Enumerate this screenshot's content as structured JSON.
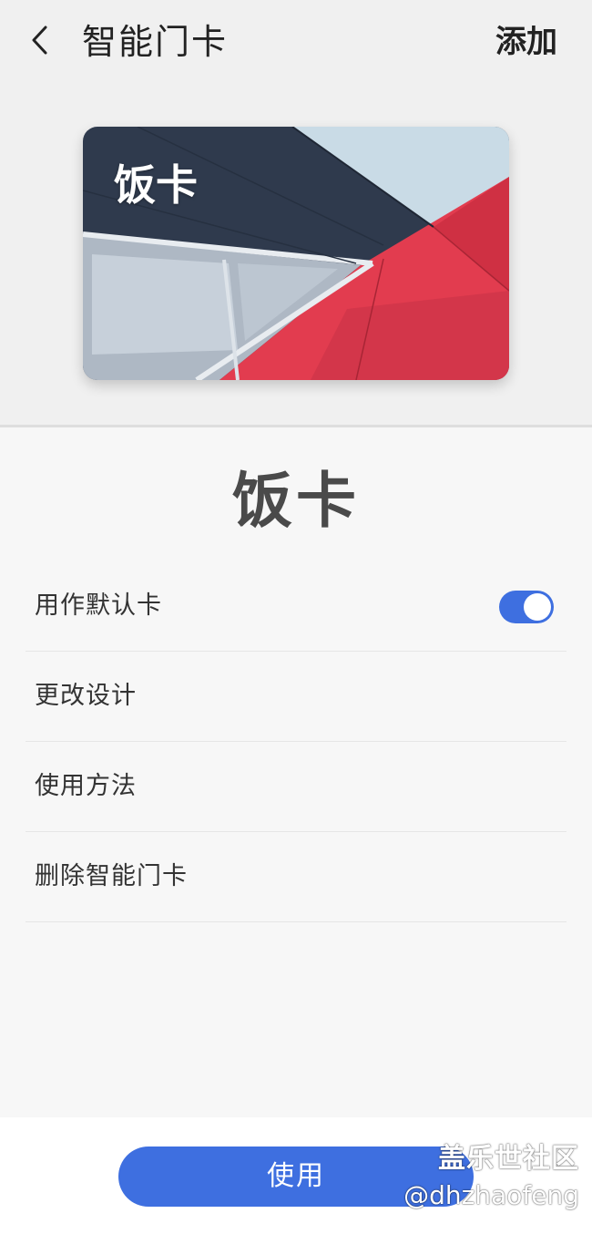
{
  "header": {
    "title": "智能门卡",
    "add_label": "添加"
  },
  "card": {
    "name": "饭卡"
  },
  "detail": {
    "title": "饭卡"
  },
  "settings": {
    "default_card_label": "用作默认卡",
    "default_card_enabled": true,
    "change_design_label": "更改设计",
    "usage_label": "使用方法",
    "delete_label": "删除智能门卡"
  },
  "footer": {
    "use_label": "使用"
  },
  "watermark": {
    "line1": "盖乐世社区",
    "line2": "@dhzhaofeng"
  },
  "colors": {
    "accent": "#3e6fe0"
  }
}
